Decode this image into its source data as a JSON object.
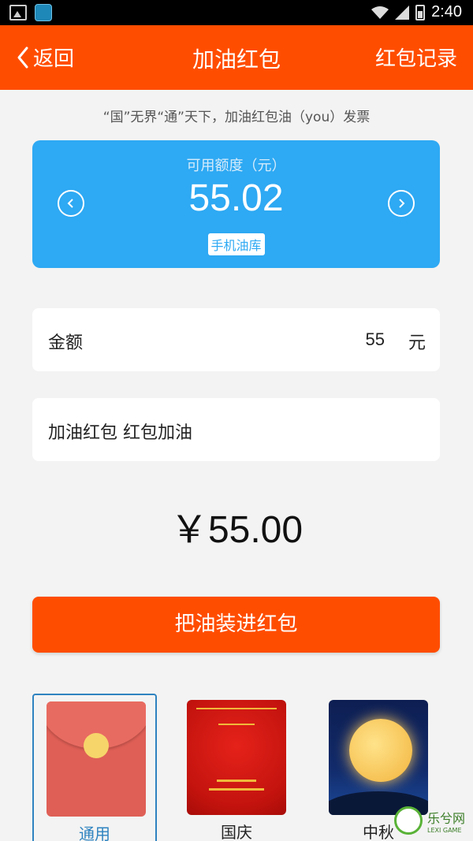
{
  "status_bar": {
    "time": "2:40"
  },
  "header": {
    "back_label": "返回",
    "title": "加油红包",
    "records_label": "红包记录",
    "color": "#ff4d00"
  },
  "slogan": "“国”无界“通”天下，加油红包油（you）发票",
  "balance": {
    "label": "可用额度（元）",
    "value": "55.02",
    "source": "手机油库",
    "color": "#2ea9f3"
  },
  "amount": {
    "label": "金额",
    "value": "55",
    "unit": "元"
  },
  "message": {
    "text": "加油红包 红包加油"
  },
  "total": "￥55.00",
  "submit_label": "把油装进红包",
  "themes": [
    {
      "label": "通用",
      "selected": true
    },
    {
      "label": "国庆",
      "selected": false
    },
    {
      "label": "中秋",
      "selected": false
    }
  ],
  "watermark": {
    "text": "乐兮网",
    "sub": "LEXI GAME"
  }
}
